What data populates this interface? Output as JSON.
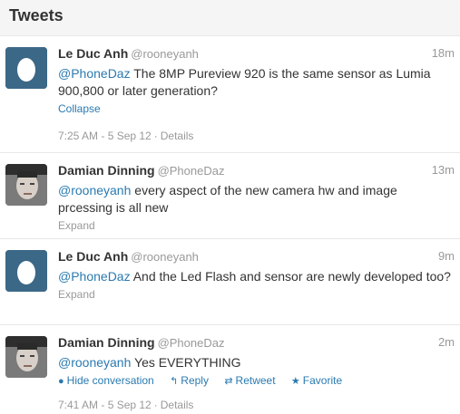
{
  "header": {
    "title": "Tweets"
  },
  "tweets": [
    {
      "author": "Le Duc Anh",
      "handle": "@rooneyanh",
      "time": "18m",
      "mention": "@PhoneDaz",
      "text": " The 8MP Pureview 920 is the same sensor as Lumia 900,800 or later generation?",
      "toggle": "Collapse",
      "date": "7:25 AM - 5 Sep 12",
      "details": "Details",
      "avatar": "egg-avatar"
    },
    {
      "author": "Damian Dinning",
      "handle": "@PhoneDaz",
      "time": "13m",
      "mention": "@rooneyanh",
      "text": " every aspect of the new camera hw and image prcessing is all new",
      "toggle": "Expand",
      "avatar": "photo-avatar"
    },
    {
      "author": "Le Duc Anh",
      "handle": "@rooneyanh",
      "time": "9m",
      "mention": "@PhoneDaz",
      "text": " And the Led Flash and sensor are newly developed too?",
      "toggle": "Expand",
      "avatar": "egg-avatar"
    },
    {
      "author": "Damian Dinning",
      "handle": "@PhoneDaz",
      "time": "2m",
      "mention": "@rooneyanh",
      "text": " Yes EVERYTHING",
      "actions": {
        "hide": "Hide conversation",
        "reply": "Reply",
        "retweet": "Retweet",
        "favorite": "Favorite"
      },
      "date": "7:41 AM - 5 Sep 12",
      "details": "Details",
      "avatar": "photo-avatar"
    }
  ],
  "colors": {
    "link": "#2a7ab0",
    "muted": "#999999",
    "egg_bg": "#3c6887"
  }
}
